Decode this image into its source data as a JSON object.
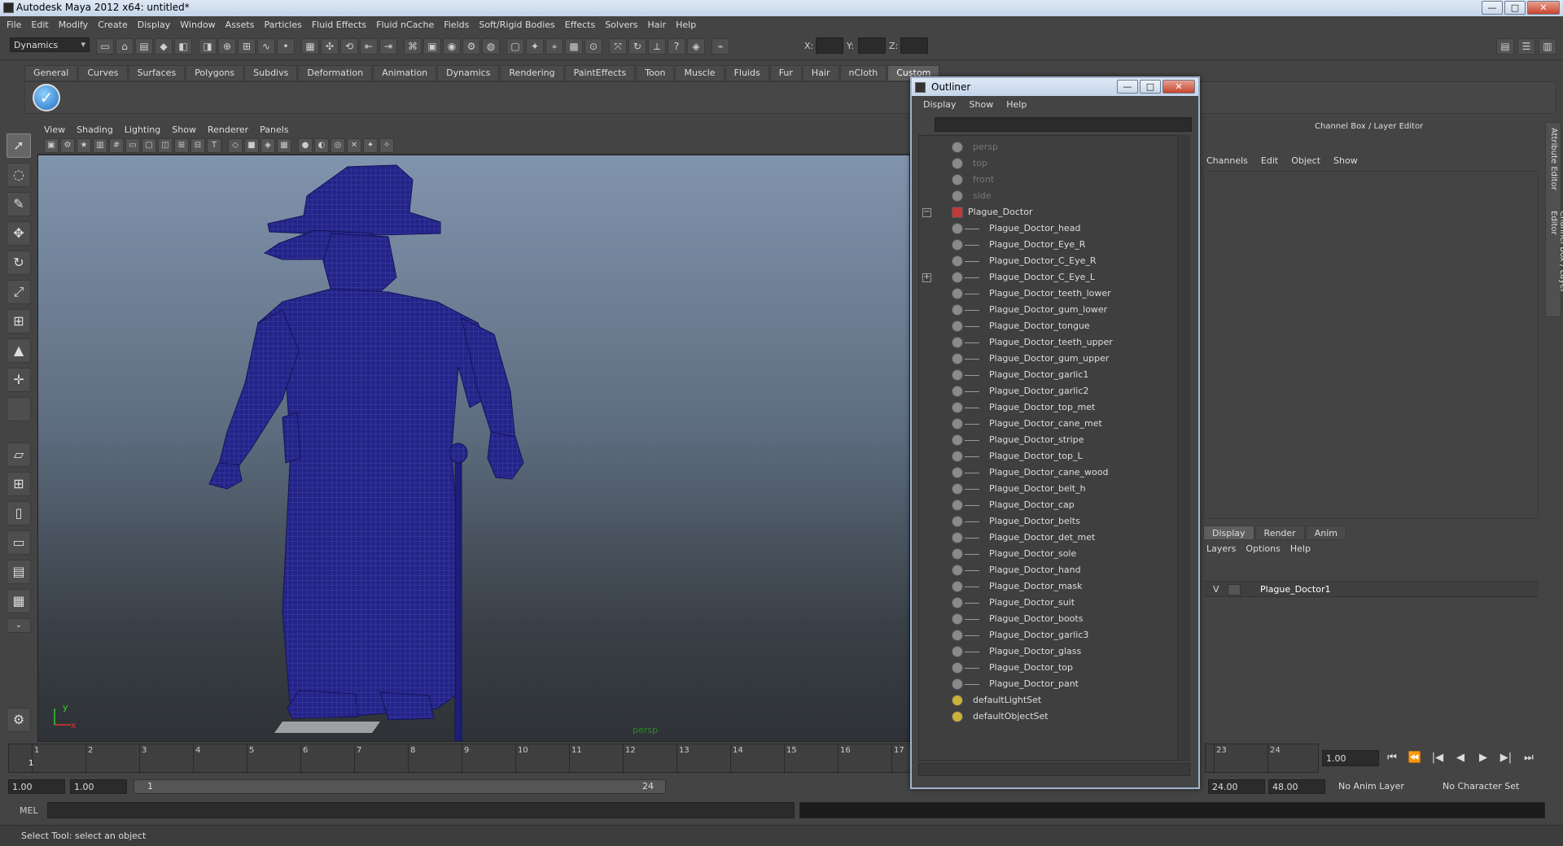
{
  "window": {
    "title": "Autodesk Maya 2012 x64: untitled*",
    "minimize": "—",
    "maximize": "□",
    "close": "✕"
  },
  "menubar": [
    "File",
    "Edit",
    "Modify",
    "Create",
    "Display",
    "Window",
    "Assets",
    "Particles",
    "Fluid Effects",
    "Fluid nCache",
    "Fields",
    "Soft/Rigid Bodies",
    "Effects",
    "Solvers",
    "Hair",
    "Help"
  ],
  "statusline": {
    "menu_set": "Dynamics",
    "x_label": "X:",
    "y_label": "Y:",
    "z_label": "Z:"
  },
  "shelf": {
    "tabs": [
      "General",
      "Curves",
      "Surfaces",
      "Polygons",
      "Subdivs",
      "Deformation",
      "Animation",
      "Dynamics",
      "Rendering",
      "PaintEffects",
      "Toon",
      "Muscle",
      "Fluids",
      "Fur",
      "Hair",
      "nCloth",
      "Custom"
    ],
    "active_tab": "Custom",
    "button_glyph": "✓"
  },
  "viewport": {
    "menu": [
      "View",
      "Shading",
      "Lighting",
      "Show",
      "Renderer",
      "Panels"
    ],
    "camera_label": "persp",
    "axis_x": "x",
    "axis_y": "y",
    "wire_color": "#1e1f7a"
  },
  "timeline": {
    "ticks": [
      "1",
      "2",
      "3",
      "4",
      "5",
      "6",
      "7",
      "8",
      "9",
      "10",
      "11",
      "12",
      "13",
      "14",
      "15",
      "16",
      "17"
    ],
    "ticks_right": [
      "23",
      "24"
    ],
    "current_marker": "1",
    "current_frame": "1.00"
  },
  "playback": [
    "⏮",
    "⏪",
    "|◀",
    "◀",
    "▶",
    "▶|",
    "⏭"
  ],
  "range": {
    "start_time": "1.00",
    "playback_start": "1.00",
    "range_start": "1",
    "range_end": "24",
    "playback_end": "24.00",
    "end_time": "48.00",
    "anim_layer": "No Anim Layer",
    "character_set": "No Character Set"
  },
  "commandline": {
    "label": "MEL"
  },
  "helpline": "Select Tool: select an object",
  "channelbox": {
    "title": "Channel Box / Layer Editor",
    "menu": [
      "Channels",
      "Edit",
      "Object",
      "Show"
    ],
    "side_tabs": [
      "Attribute Editor",
      "Channel Box / Layer Editor"
    ]
  },
  "layereditor": {
    "tabs": [
      "Display",
      "Render",
      "Anim"
    ],
    "active_tab": "Display",
    "menu": [
      "Layers",
      "Options",
      "Help"
    ],
    "layer": {
      "visibility": "V",
      "name": "Plague_Doctor1"
    }
  },
  "outliner": {
    "title": "Outliner",
    "menu": [
      "Display",
      "Show",
      "Help"
    ],
    "cameras": [
      "persp",
      "top",
      "front",
      "side"
    ],
    "root": "Plague_Doctor",
    "children": [
      "Plague_Doctor_head",
      "Plague_Doctor_Eye_R",
      "Plague_Doctor_C_Eye_R",
      "Plague_Doctor_C_Eye_L",
      "Plague_Doctor_teeth_lower",
      "Plague_Doctor_gum_lower",
      "Plague_Doctor_tongue",
      "Plague_Doctor_teeth_upper",
      "Plague_Doctor_gum_upper",
      "Plague_Doctor_garlic1",
      "Plague_Doctor_garlic2",
      "Plague_Doctor_top_met",
      "Plague_Doctor_cane_met",
      "Plague_Doctor_stripe",
      "Plague_Doctor_top_L",
      "Plague_Doctor_cane_wood",
      "Plague_Doctor_belt_h",
      "Plague_Doctor_cap",
      "Plague_Doctor_belts",
      "Plague_Doctor_det_met",
      "Plague_Doctor_sole",
      "Plague_Doctor_hand",
      "Plague_Doctor_mask",
      "Plague_Doctor_suit",
      "Plague_Doctor_boots",
      "Plague_Doctor_garlic3",
      "Plague_Doctor_glass",
      "Plague_Doctor_top",
      "Plague_Doctor_pant"
    ],
    "sets": [
      "defaultLightSet",
      "defaultObjectSet"
    ]
  }
}
